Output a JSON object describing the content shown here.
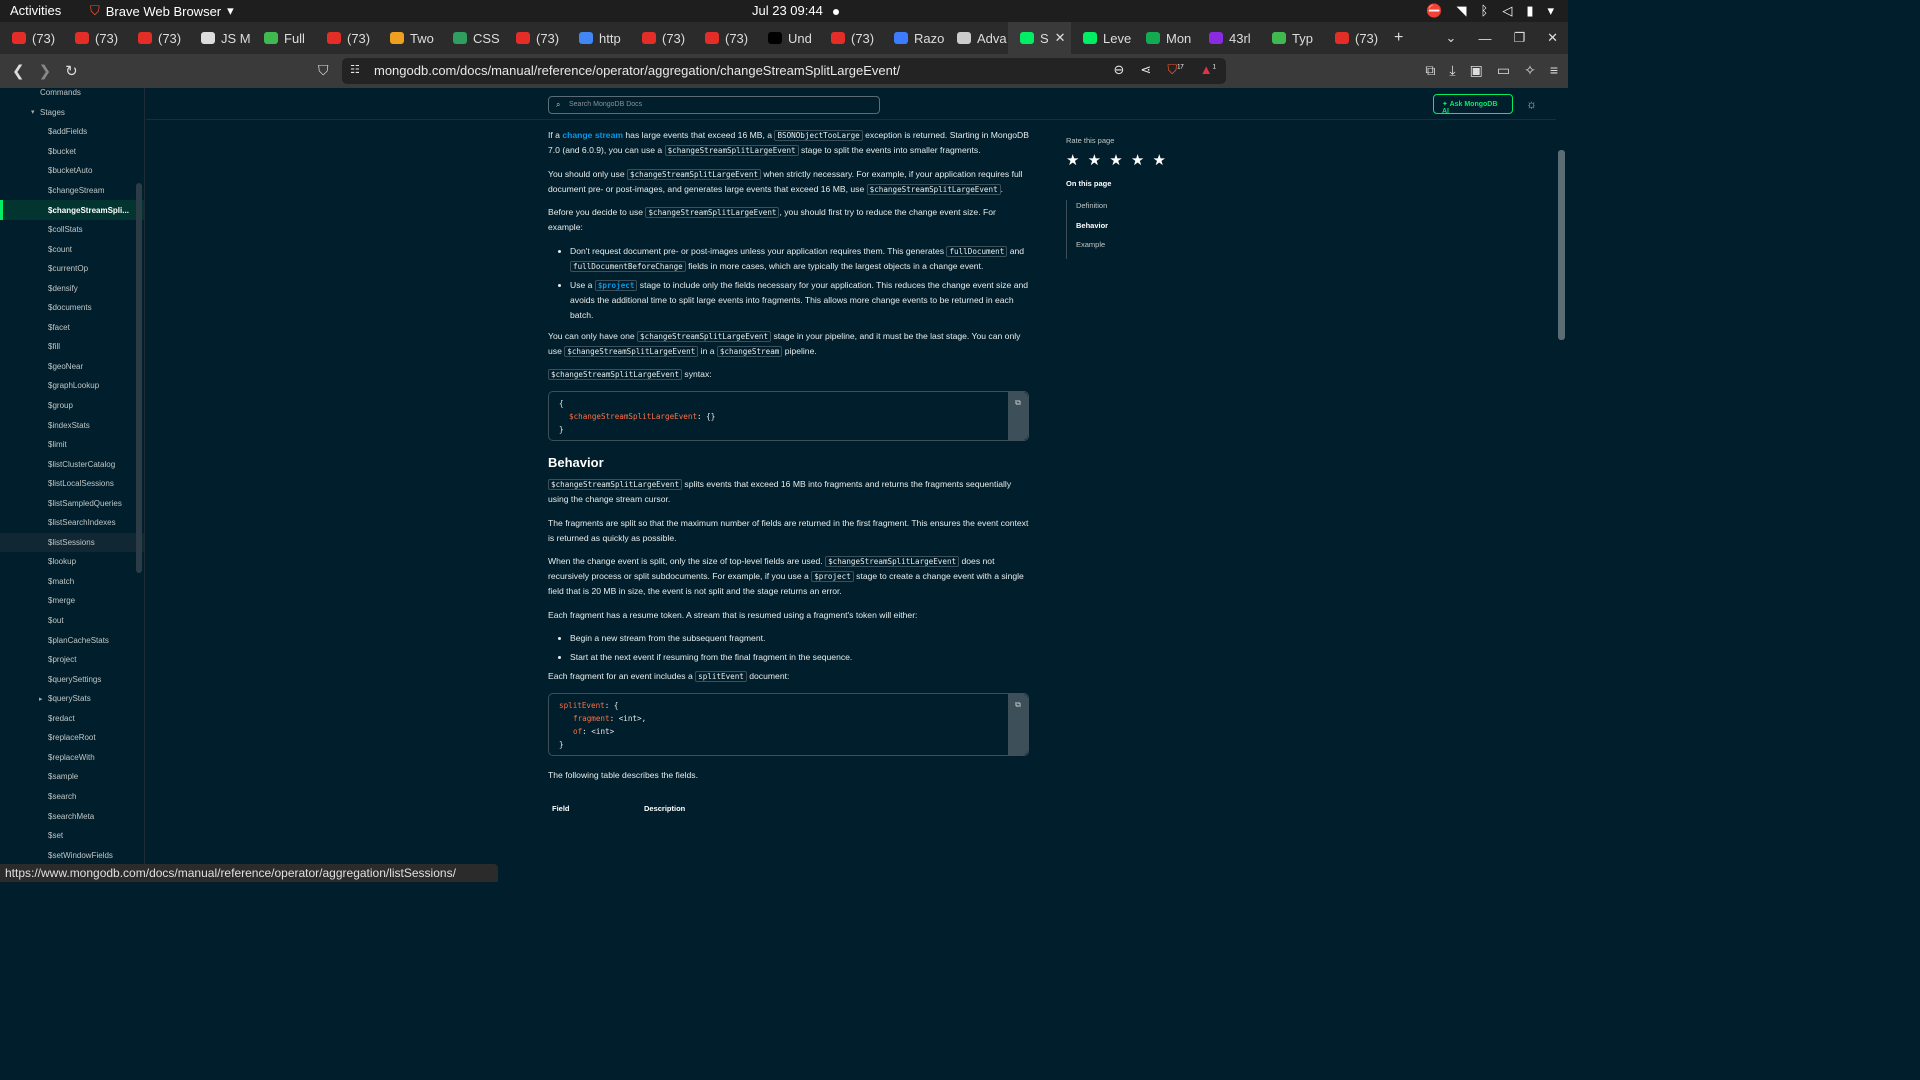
{
  "system": {
    "activities": "Activities",
    "app_name": "Brave Web Browser",
    "clock": "Jul 23  09:44"
  },
  "tabs": [
    {
      "label": "(73)",
      "color": "#e52d27"
    },
    {
      "label": "(73)",
      "color": "#e52d27"
    },
    {
      "label": "(73)",
      "color": "#e52d27"
    },
    {
      "label": "JS M",
      "color": "#dddddd"
    },
    {
      "label": "Full",
      "color": "#3fb950"
    },
    {
      "label": "(73)",
      "color": "#e52d27"
    },
    {
      "label": "Two",
      "color": "#f0a020"
    },
    {
      "label": "CSS",
      "color": "#2f9e5f"
    },
    {
      "label": "(73)",
      "color": "#e52d27"
    },
    {
      "label": "http",
      "color": "#4285f4"
    },
    {
      "label": "(73)",
      "color": "#e52d27"
    },
    {
      "label": "(73)",
      "color": "#e52d27"
    },
    {
      "label": "Und",
      "color": "#000000"
    },
    {
      "label": "(73)",
      "color": "#e52d27"
    },
    {
      "label": "Razo",
      "color": "#3d7bff"
    },
    {
      "label": "Adva",
      "color": "#cccccc"
    },
    {
      "label": "S",
      "color": "#00ed64",
      "active": true
    },
    {
      "label": "Leve",
      "color": "#00ed64"
    },
    {
      "label": "Mon",
      "color": "#13aa52"
    },
    {
      "label": "43rl",
      "color": "#8a2be2"
    },
    {
      "label": "Typ",
      "color": "#3fb950"
    },
    {
      "label": "(73)",
      "color": "#e52d27"
    }
  ],
  "toolbar": {
    "url": "mongodb.com/docs/manual/reference/operator/aggregation/changeStreamSplitLargeEvent/",
    "shield_badge": "17",
    "rewards_badge": "1"
  },
  "docs_header": {
    "search_placeholder": "Search MongoDB Docs",
    "ask_label": "Ask MongoDB AI"
  },
  "sidebar": {
    "commands": "Commands",
    "stages": "Stages",
    "items": [
      "$addFields",
      "$bucket",
      "$bucketAuto",
      "$changeStream",
      "$changeStreamSpli...",
      "$collStats",
      "$count",
      "$currentOp",
      "$densify",
      "$documents",
      "$facet",
      "$fill",
      "$geoNear",
      "$graphLookup",
      "$group",
      "$indexStats",
      "$limit",
      "$listClusterCatalog",
      "$listLocalSessions",
      "$listSampledQueries",
      "$listSearchIndexes",
      "$listSessions",
      "$lookup",
      "$match",
      "$merge",
      "$out",
      "$planCacheStats",
      "$project",
      "$querySettings",
      "$queryStats",
      "$redact",
      "$replaceRoot",
      "$replaceWith",
      "$sample",
      "$search",
      "$searchMeta",
      "$set",
      "$setWindowFields"
    ]
  },
  "content": {
    "p1": [
      "If a ",
      "change stream",
      " has large events that exceed 16 MB, a ",
      "BSONObjectTooLarge",
      " exception is returned. Starting in MongoDB 7.0 (and 6.0.9), you can use a ",
      "$changeStreamSplitLargeEvent",
      " stage to split the events into smaller fragments."
    ],
    "p2": [
      "You should only use ",
      "$changeStreamSplitLargeEvent",
      " when strictly necessary. For example, if your application requires full document pre- or post-images, and generates large events that exceed 16 MB, use ",
      "$changeStreamSplitLargeEvent",
      "."
    ],
    "p3": [
      "Before you decide to use ",
      "$changeStreamSplitLargeEvent",
      ", you should first try to reduce the change event size. For example:"
    ],
    "b1": [
      "Don't request document pre- or post-images unless your application requires them. This generates ",
      "fullDocument",
      " and ",
      "fullDocumentBeforeChange",
      " fields in more cases, which are typically the largest objects in a change event."
    ],
    "b2": [
      "Use a ",
      "$project",
      " stage to include only the fields necessary for your application. This reduces the change event size and avoids the additional time to split large events into fragments. This allows more change events to be returned in each batch."
    ],
    "p4": [
      "You can only have one ",
      "$changeStreamSplitLargeEvent",
      " stage in your pipeline, and it must be the last stage. You can only use ",
      "$changeStreamSplitLargeEvent",
      " in a ",
      "$changeStream",
      " pipeline."
    ],
    "p5": [
      "$changeStreamSplitLargeEvent",
      " syntax:"
    ],
    "code1": [
      "{",
      "$changeStreamSplitLargeEvent",
      ": {}",
      "}"
    ],
    "behavior_heading": "Behavior",
    "p6": [
      "$changeStreamSplitLargeEvent",
      " splits events that exceed 16 MB into fragments and returns the fragments sequentially using the change stream cursor."
    ],
    "p7": "The fragments are split so that the maximum number of fields are returned in the first fragment. This ensures the event context is returned as quickly as possible.",
    "p8": [
      "When the change event is split, only the size of top-level fields are used. ",
      "$changeStreamSplitLargeEvent",
      " does not recursively process or split subdocuments. For example, if you use a ",
      "$project",
      " stage to create a change event with a single field that is 20 MB in size, the event is not split and the stage returns an error."
    ],
    "p9": "Each fragment has a resume token. A stream that is resumed using a fragment's token will either:",
    "b3": "Begin a new stream from the subsequent fragment.",
    "b4": "Start at the next event if resuming from the final fragment in the sequence.",
    "p10": [
      "Each fragment for an event includes a ",
      "splitEvent",
      " document:"
    ],
    "code2": [
      "splitEvent",
      ": {",
      "fragment",
      ": <int>,",
      "of",
      ": <int>",
      "}"
    ],
    "p11": "The following table describes the fields.",
    "table_headers": [
      "Field",
      "Description"
    ]
  },
  "rail": {
    "rate": "Rate this page",
    "stars": "★ ★ ★ ★ ★",
    "on_this_page": "On this page",
    "toc": [
      "Definition",
      "Behavior",
      "Example"
    ]
  },
  "status_url": "https://www.mongodb.com/docs/manual/reference/operator/aggregation/listSessions/"
}
